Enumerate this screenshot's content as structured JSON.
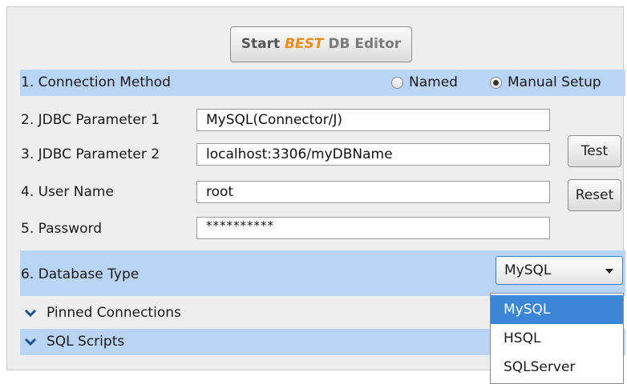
{
  "header": {
    "start_prefix": "Start ",
    "start_brand": "BEST",
    "start_suffix": " DB Editor",
    "brand_color": "#f08a1a"
  },
  "connection_method": {
    "label": "1. Connection Method",
    "options": [
      {
        "label": "Named",
        "selected": false
      },
      {
        "label": "Manual Setup",
        "selected": true
      }
    ]
  },
  "fields": {
    "jdbc1": {
      "label": "2. JDBC Parameter 1",
      "value": "MySQL(Connector/J)"
    },
    "jdbc2": {
      "label": "3. JDBC Parameter 2",
      "value": "localhost:3306/myDBName"
    },
    "username": {
      "label": "4. User Name",
      "value": "root"
    },
    "password": {
      "label": "5. Password",
      "value": "**********"
    }
  },
  "buttons": {
    "test": "Test",
    "reset": "Reset"
  },
  "database_type": {
    "label": "6. Database Type",
    "selected": "MySQL",
    "options": [
      "MySQL",
      "HSQL",
      "SQLServer"
    ]
  },
  "sections": {
    "pinned": "Pinned Connections",
    "sql_scripts": "SQL Scripts"
  },
  "colors": {
    "band": "#b9d4f5",
    "selection": "#3b86d6"
  },
  "icons": [
    "chevron-down-icon",
    "radio-icon",
    "dropdown-arrow-icon"
  ]
}
